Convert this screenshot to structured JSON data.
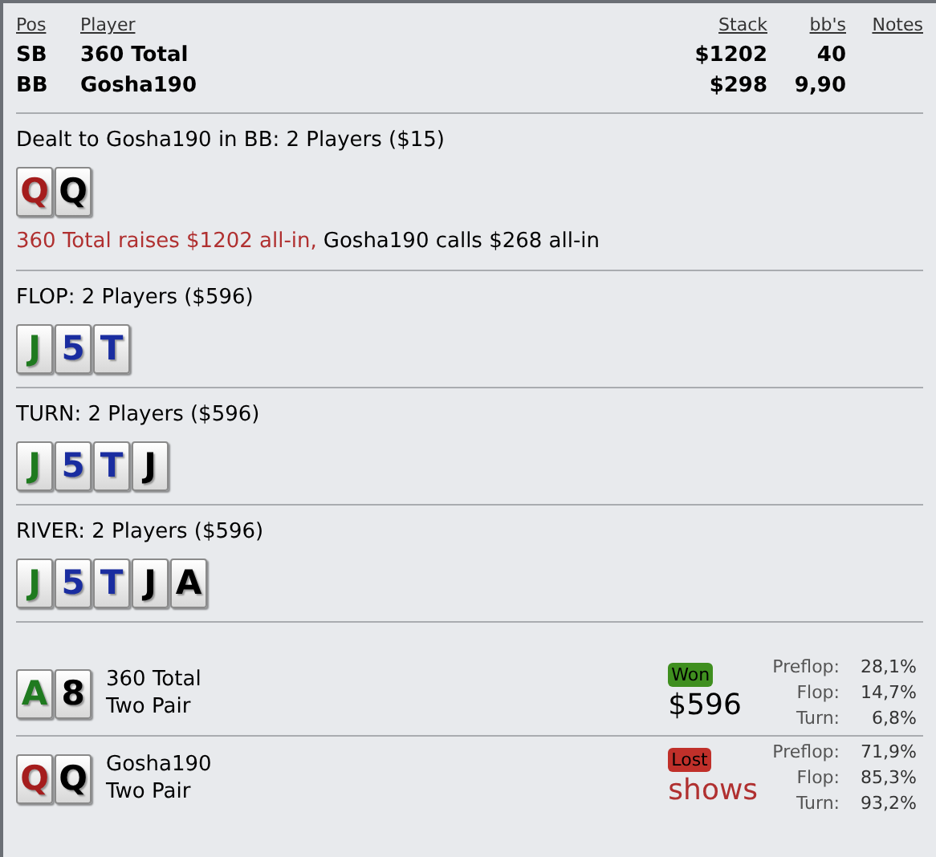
{
  "players_table": {
    "columns": [
      "Pos",
      "Player",
      "Stack",
      "bb's",
      "Notes"
    ],
    "rows": [
      {
        "pos": "SB",
        "player": "360 Total",
        "stack": "$1202",
        "bbs": "40"
      },
      {
        "pos": "BB",
        "player": "Gosha190",
        "stack": "$298",
        "bbs": "9,90"
      }
    ]
  },
  "streets": [
    {
      "title": "Dealt to Gosha190 in BB: 2 Players ($15)",
      "cards": [
        {
          "rank": "Q",
          "color": "#a51d1d"
        },
        {
          "rank": "Q",
          "color": "#000000"
        }
      ],
      "actions": [
        {
          "text": "360 Total raises $1202 all-in,",
          "color": "#b03030"
        },
        {
          "text": "Gosha190 calls $268 all-in",
          "color": "#000000"
        }
      ]
    },
    {
      "title": "FLOP: 2 Players ($596)",
      "cards": [
        {
          "rank": "J",
          "color": "#1f7a1f"
        },
        {
          "rank": "5",
          "color": "#1a2da0"
        },
        {
          "rank": "T",
          "color": "#1a2da0"
        }
      ]
    },
    {
      "title": "TURN: 2 Players ($596)",
      "cards": [
        {
          "rank": "J",
          "color": "#1f7a1f"
        },
        {
          "rank": "5",
          "color": "#1a2da0"
        },
        {
          "rank": "T",
          "color": "#1a2da0"
        },
        {
          "rank": "J",
          "color": "#000000"
        }
      ]
    },
    {
      "title": "RIVER: 2 Players ($596)",
      "cards": [
        {
          "rank": "J",
          "color": "#1f7a1f"
        },
        {
          "rank": "5",
          "color": "#1a2da0"
        },
        {
          "rank": "T",
          "color": "#1a2da0"
        },
        {
          "rank": "J",
          "color": "#000000"
        },
        {
          "rank": "A",
          "color": "#000000"
        }
      ]
    }
  ],
  "showdown": [
    {
      "cards": [
        {
          "rank": "A",
          "color": "#1f7a1f"
        },
        {
          "rank": "8",
          "color": "#000000"
        }
      ],
      "player": "360 Total",
      "hand": "Two Pair",
      "kind": "won",
      "badge": "Won",
      "result": "$596",
      "equity": [
        {
          "label": "Preflop:",
          "value": "28,1%"
        },
        {
          "label": "Flop:",
          "value": "14,7%"
        },
        {
          "label": "Turn:",
          "value": "6,8%"
        }
      ]
    },
    {
      "cards": [
        {
          "rank": "Q",
          "color": "#a51d1d"
        },
        {
          "rank": "Q",
          "color": "#000000"
        }
      ],
      "player": "Gosha190",
      "hand": "Two Pair",
      "kind": "lost",
      "badge": "Lost",
      "result": "shows",
      "equity": [
        {
          "label": "Preflop:",
          "value": "71,9%"
        },
        {
          "label": "Flop:",
          "value": "85,3%"
        },
        {
          "label": "Turn:",
          "value": "93,2%"
        }
      ]
    }
  ]
}
